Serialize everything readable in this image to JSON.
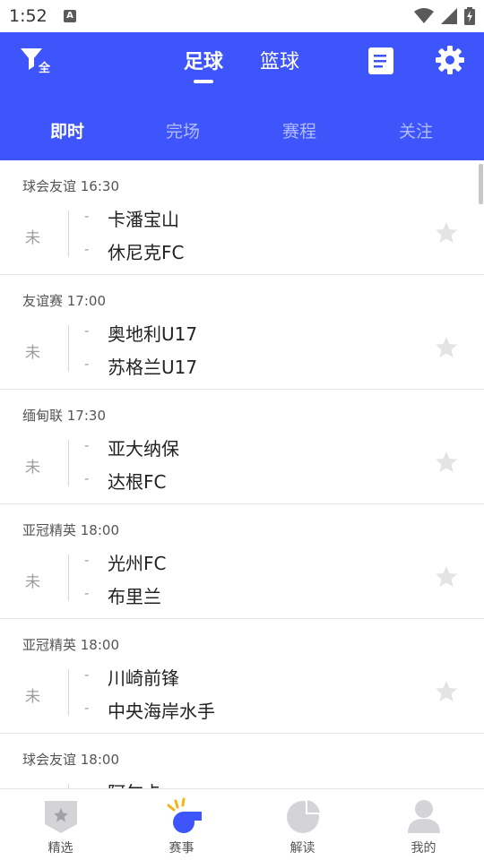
{
  "status_bar": {
    "time": "1:52",
    "notification_glyph": "A"
  },
  "header": {
    "filter_label": "全",
    "sport_tabs": [
      {
        "label": "足球",
        "active": true
      },
      {
        "label": "篮球",
        "active": false
      }
    ],
    "sub_tabs": [
      {
        "label": "即时",
        "active": true
      },
      {
        "label": "完场"
      },
      {
        "label": "赛程"
      },
      {
        "label": "关注"
      }
    ],
    "accent_color": "#3d55fb"
  },
  "matches": [
    {
      "league_time": "球会友谊 16:30",
      "status": "未",
      "home": "卡潘宝山",
      "away": "休尼克FC",
      "home_score": "-",
      "away_score": "-"
    },
    {
      "league_time": "友谊赛 17:00",
      "status": "未",
      "home": "奥地利U17",
      "away": "苏格兰U17",
      "home_score": "-",
      "away_score": "-"
    },
    {
      "league_time": "缅甸联 17:30",
      "status": "未",
      "home": "亚大纳保",
      "away": "达根FC",
      "home_score": "-",
      "away_score": "-"
    },
    {
      "league_time": "亚冠精英 18:00",
      "status": "未",
      "home": "光州FC",
      "away": "布里兰",
      "home_score": "-",
      "away_score": "-"
    },
    {
      "league_time": "亚冠精英 18:00",
      "status": "未",
      "home": "川崎前锋",
      "away": "中央海岸水手",
      "home_score": "-",
      "away_score": "-"
    },
    {
      "league_time": "球会友谊 18:00",
      "status": "未",
      "home": "阿尔卡",
      "away": "",
      "home_score": "-",
      "away_score": "-"
    }
  ],
  "bottom_nav": [
    {
      "label": "精选",
      "icon": "shield-star-icon",
      "active": false
    },
    {
      "label": "赛事",
      "icon": "whistle-icon",
      "active": true
    },
    {
      "label": "解读",
      "icon": "pie-chart-icon",
      "active": false
    },
    {
      "label": "我的",
      "icon": "person-icon",
      "active": false
    }
  ]
}
